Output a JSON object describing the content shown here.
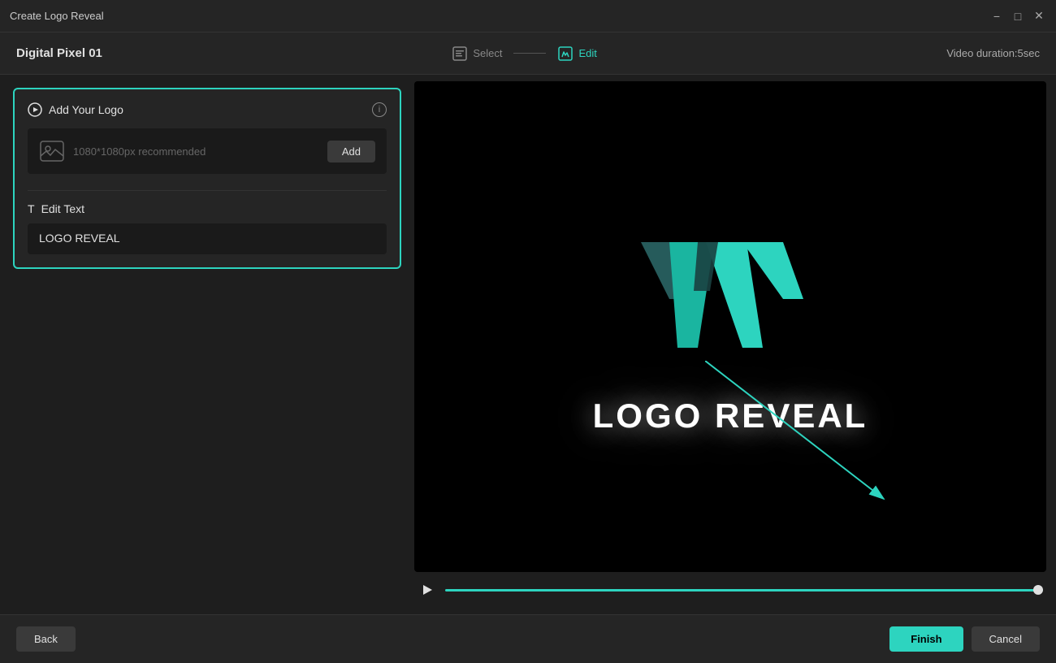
{
  "window": {
    "title": "Create Logo Reveal"
  },
  "titlebar": {
    "title": "Create Logo Reveal",
    "minimize_label": "−",
    "restore_label": "□",
    "close_label": "✕"
  },
  "header": {
    "project_title": "Digital Pixel 01",
    "step_select_label": "Select",
    "step_edit_label": "Edit",
    "duration_label": "Video duration:",
    "duration_value": "5sec"
  },
  "left_panel": {
    "add_logo_section": {
      "title": "Add Your Logo",
      "hint": "1080*1080px recommended",
      "add_button_label": "Add"
    },
    "edit_text_section": {
      "title": "Edit Text",
      "text_value": "LOGO REVEAL"
    }
  },
  "preview": {
    "logo_text": "LOGO REVEAL"
  },
  "footer": {
    "back_button_label": "Back",
    "finish_button_label": "Finish",
    "cancel_button_label": "Cancel"
  }
}
